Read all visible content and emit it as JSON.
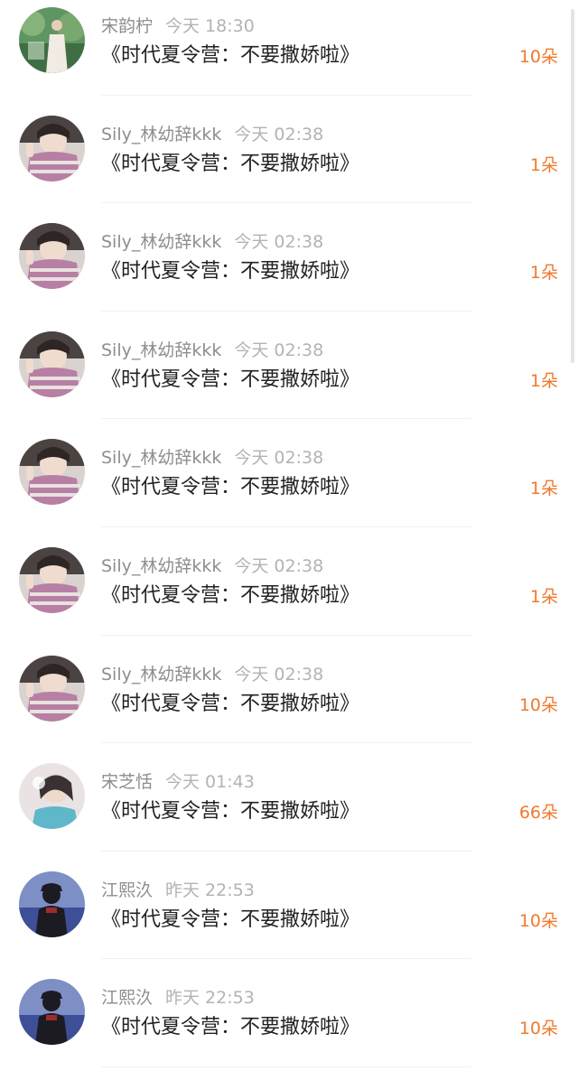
{
  "rows": [
    {
      "username": "宋韵柠",
      "time": "今天 18:30",
      "title": "《时代夏令营：不要撒娇啦》",
      "amount": "10朵",
      "avatar_icon": "garden-photo-avatar"
    },
    {
      "username": "Sily_林幼辞kkk",
      "time": "今天 02:38",
      "title": "《时代夏令营：不要撒娇啦》",
      "amount": "1朵",
      "avatar_icon": "peace-sign-selfie-avatar"
    },
    {
      "username": "Sily_林幼辞kkk",
      "time": "今天 02:38",
      "title": "《时代夏令营：不要撒娇啦》",
      "amount": "1朵",
      "avatar_icon": "peace-sign-selfie-avatar"
    },
    {
      "username": "Sily_林幼辞kkk",
      "time": "今天 02:38",
      "title": "《时代夏令营：不要撒娇啦》",
      "amount": "1朵",
      "avatar_icon": "peace-sign-selfie-avatar"
    },
    {
      "username": "Sily_林幼辞kkk",
      "time": "今天 02:38",
      "title": "《时代夏令营：不要撒娇啦》",
      "amount": "1朵",
      "avatar_icon": "peace-sign-selfie-avatar"
    },
    {
      "username": "Sily_林幼辞kkk",
      "time": "今天 02:38",
      "title": "《时代夏令营：不要撒娇啦》",
      "amount": "1朵",
      "avatar_icon": "peace-sign-selfie-avatar"
    },
    {
      "username": "Sily_林幼辞kkk",
      "time": "今天 02:38",
      "title": "《时代夏令营：不要撒娇啦》",
      "amount": "10朵",
      "avatar_icon": "peace-sign-selfie-avatar"
    },
    {
      "username": "宋芝恬",
      "time": "今天 01:43",
      "title": "《时代夏令营：不要撒娇啦》",
      "amount": "66朵",
      "avatar_icon": "girl-portrait-avatar"
    },
    {
      "username": "江熙汣",
      "time": "昨天 22:53",
      "title": "《时代夏令营：不要撒娇啦》",
      "amount": "10朵",
      "avatar_icon": "seaside-silhouette-avatar"
    },
    {
      "username": "江熙汣",
      "time": "昨天 22:53",
      "title": "《时代夏令营：不要撒娇啦》",
      "amount": "10朵",
      "avatar_icon": "seaside-silhouette-avatar"
    }
  ],
  "colors": {
    "amount": "#ef7a2c",
    "username": "#8e8e8e",
    "time": "#b3b3b3",
    "title": "#222222"
  }
}
